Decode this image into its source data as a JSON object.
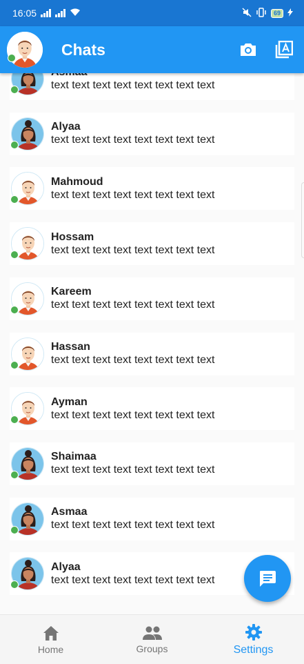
{
  "status_bar": {
    "time": "16:05",
    "battery": "69"
  },
  "app_bar": {
    "title": "Chats",
    "camera_icon": "camera-icon",
    "contacts_icon": "contacts-icon"
  },
  "chats": [
    {
      "name": "Asmaa",
      "message": "text text text text text text text text",
      "avatar": "female"
    },
    {
      "name": "Alyaa",
      "message": "text text text text text text text text",
      "avatar": "female"
    },
    {
      "name": "Mahmoud",
      "message": "text text text text text text text text",
      "avatar": "male"
    },
    {
      "name": "Hossam",
      "message": "text text text text text text text text",
      "avatar": "male"
    },
    {
      "name": "Kareem",
      "message": "text text text text text text text text",
      "avatar": "male"
    },
    {
      "name": "Hassan",
      "message": "text text text text text text text text",
      "avatar": "male"
    },
    {
      "name": "Ayman",
      "message": "text text text text text text text text",
      "avatar": "male"
    },
    {
      "name": "Shaimaa",
      "message": "text text text text text text text text",
      "avatar": "female"
    },
    {
      "name": "Asmaa",
      "message": "text text text text text text text text",
      "avatar": "female"
    },
    {
      "name": "Alyaa",
      "message": "text text text text text text text text",
      "avatar": "female"
    }
  ],
  "fab": {
    "icon": "message-icon"
  },
  "bottom_nav": [
    {
      "label": "Home",
      "icon": "home-icon",
      "active": false
    },
    {
      "label": "Groups",
      "icon": "groups-icon",
      "active": false
    },
    {
      "label": "Settings",
      "icon": "settings-icon",
      "active": true
    }
  ],
  "colors": {
    "primary": "#2196f3",
    "status_bar": "#1976d2",
    "online": "#4caf50"
  }
}
